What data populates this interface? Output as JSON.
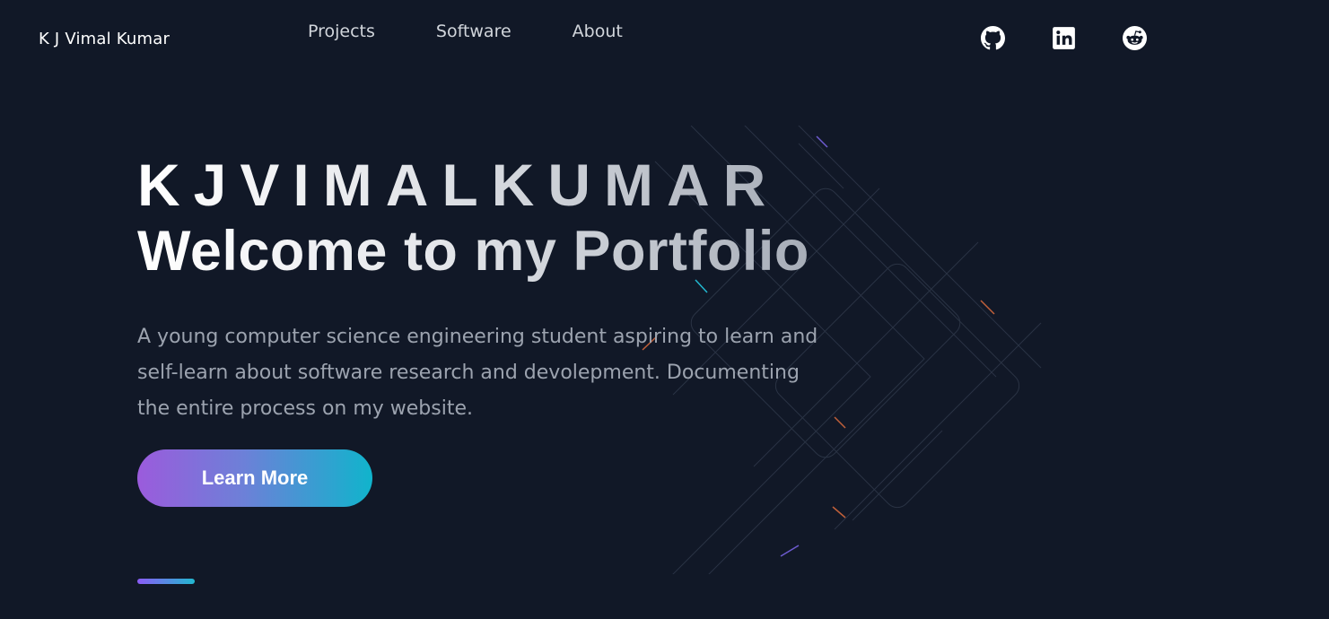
{
  "header": {
    "brand": "K J Vimal Kumar",
    "nav": [
      {
        "label": "Projects"
      },
      {
        "label": "Software"
      },
      {
        "label": "About"
      }
    ],
    "social": [
      {
        "icon": "github-icon"
      },
      {
        "icon": "linkedin-icon"
      },
      {
        "icon": "reddit-icon"
      }
    ]
  },
  "hero": {
    "name": "KJVIMALKUMAR",
    "welcome": "Welcome to my Portfolio",
    "description": "A young computer science engineering student aspiring to learn and self-learn about software research and devolepment. Documenting the entire process on my website.",
    "cta_label": "Learn More"
  },
  "colors": {
    "background": "#111827",
    "gradient_start": "#9b5bdc",
    "gradient_end": "#10b4cc"
  }
}
